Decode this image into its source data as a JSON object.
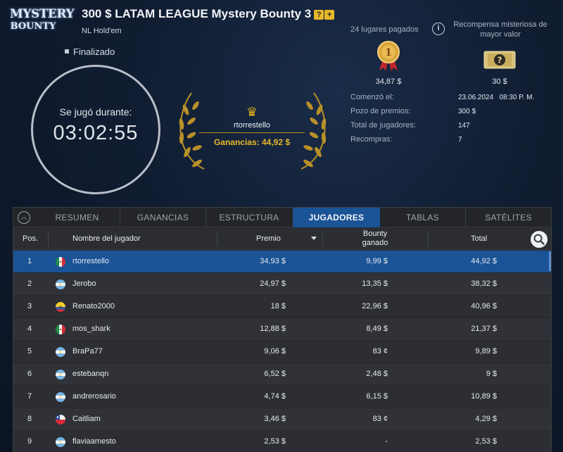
{
  "logo": {
    "line1": "MYSTERY",
    "line2": "BOUNTY"
  },
  "tournament": {
    "title": "300 $ LATAM LEAGUE Mystery Bounty 3",
    "game_type": "NL Hold'em",
    "status": "Finalizado"
  },
  "clock": {
    "label": "Se jugó durante:",
    "time": "03:02:55"
  },
  "winner": {
    "name": "rtorrestello",
    "earnings": "Ganancias: 44,92 $"
  },
  "payouts": {
    "places_paid": "24 lugares pagados",
    "mystery_label": "Recompensa misteriosa de mayor valor",
    "first_prize": "34,87 $",
    "mystery_prize": "30 $"
  },
  "stats": [
    {
      "label": "Comenzó el:",
      "value": "23.06.2024   08:30 P. M."
    },
    {
      "label": "Pozo de premios:",
      "value": "300 $"
    },
    {
      "label": "Total de jugadores:",
      "value": "147"
    },
    {
      "label": "Recompras:",
      "value": "7"
    }
  ],
  "tabs": [
    "RESUMEN",
    "GANANCIAS",
    "ESTRUCTURA",
    "JUGADORES",
    "TABLAS",
    "SATÉLITES"
  ],
  "active_tab": "JUGADORES",
  "table": {
    "headers": {
      "pos": "Pos.",
      "name": "Nombre del jugador",
      "prize": "Premio",
      "bounty_line1": "Bounty",
      "bounty_line2": "ganado",
      "total": "Total"
    },
    "rows": [
      {
        "pos": "1",
        "flag": "mx",
        "name": "rtorrestello",
        "prize": "34,93 $",
        "bounty": "9,99 $",
        "total": "44,92 $",
        "selected": true
      },
      {
        "pos": "2",
        "flag": "ar",
        "name": "Jerobo",
        "prize": "24,97 $",
        "bounty": "13,35 $",
        "total": "38,32 $"
      },
      {
        "pos": "3",
        "flag": "ec",
        "name": "Renato2000",
        "prize": "18 $",
        "bounty": "22,96 $",
        "total": "40,96 $"
      },
      {
        "pos": "4",
        "flag": "mx",
        "name": "mos_shark",
        "prize": "12,88 $",
        "bounty": "8,49 $",
        "total": "21,37 $"
      },
      {
        "pos": "5",
        "flag": "ar",
        "name": "BraPa77",
        "prize": "9,06 $",
        "bounty": "83 ¢",
        "total": "9,89 $"
      },
      {
        "pos": "6",
        "flag": "ar",
        "name": "estebanqn",
        "prize": "6,52 $",
        "bounty": "2,48 $",
        "total": "9 $"
      },
      {
        "pos": "7",
        "flag": "ar",
        "name": "andrerosario",
        "prize": "4,74 $",
        "bounty": "6,15 $",
        "total": "10,89 $"
      },
      {
        "pos": "8",
        "flag": "cl",
        "name": "Caitliam",
        "prize": "3,46 $",
        "bounty": "83 ¢",
        "total": "4,29 $"
      },
      {
        "pos": "9",
        "flag": "ar",
        "name": "flaviaamesto",
        "prize": "2,53 $",
        "bounty": "-",
        "total": "2,53 $"
      }
    ]
  },
  "colors": {
    "accent_blue": "#1a5396",
    "gold": "#e8b828",
    "panel_bg": "#2a2c31",
    "header_bg": "#101c30"
  },
  "icons": {
    "medal": "gold-medal-icon",
    "ticket": "mystery-ticket-icon",
    "crown": "crown-icon",
    "info": "info-icon",
    "search": "search-icon",
    "collapse": "collapse-chevron-icon"
  }
}
